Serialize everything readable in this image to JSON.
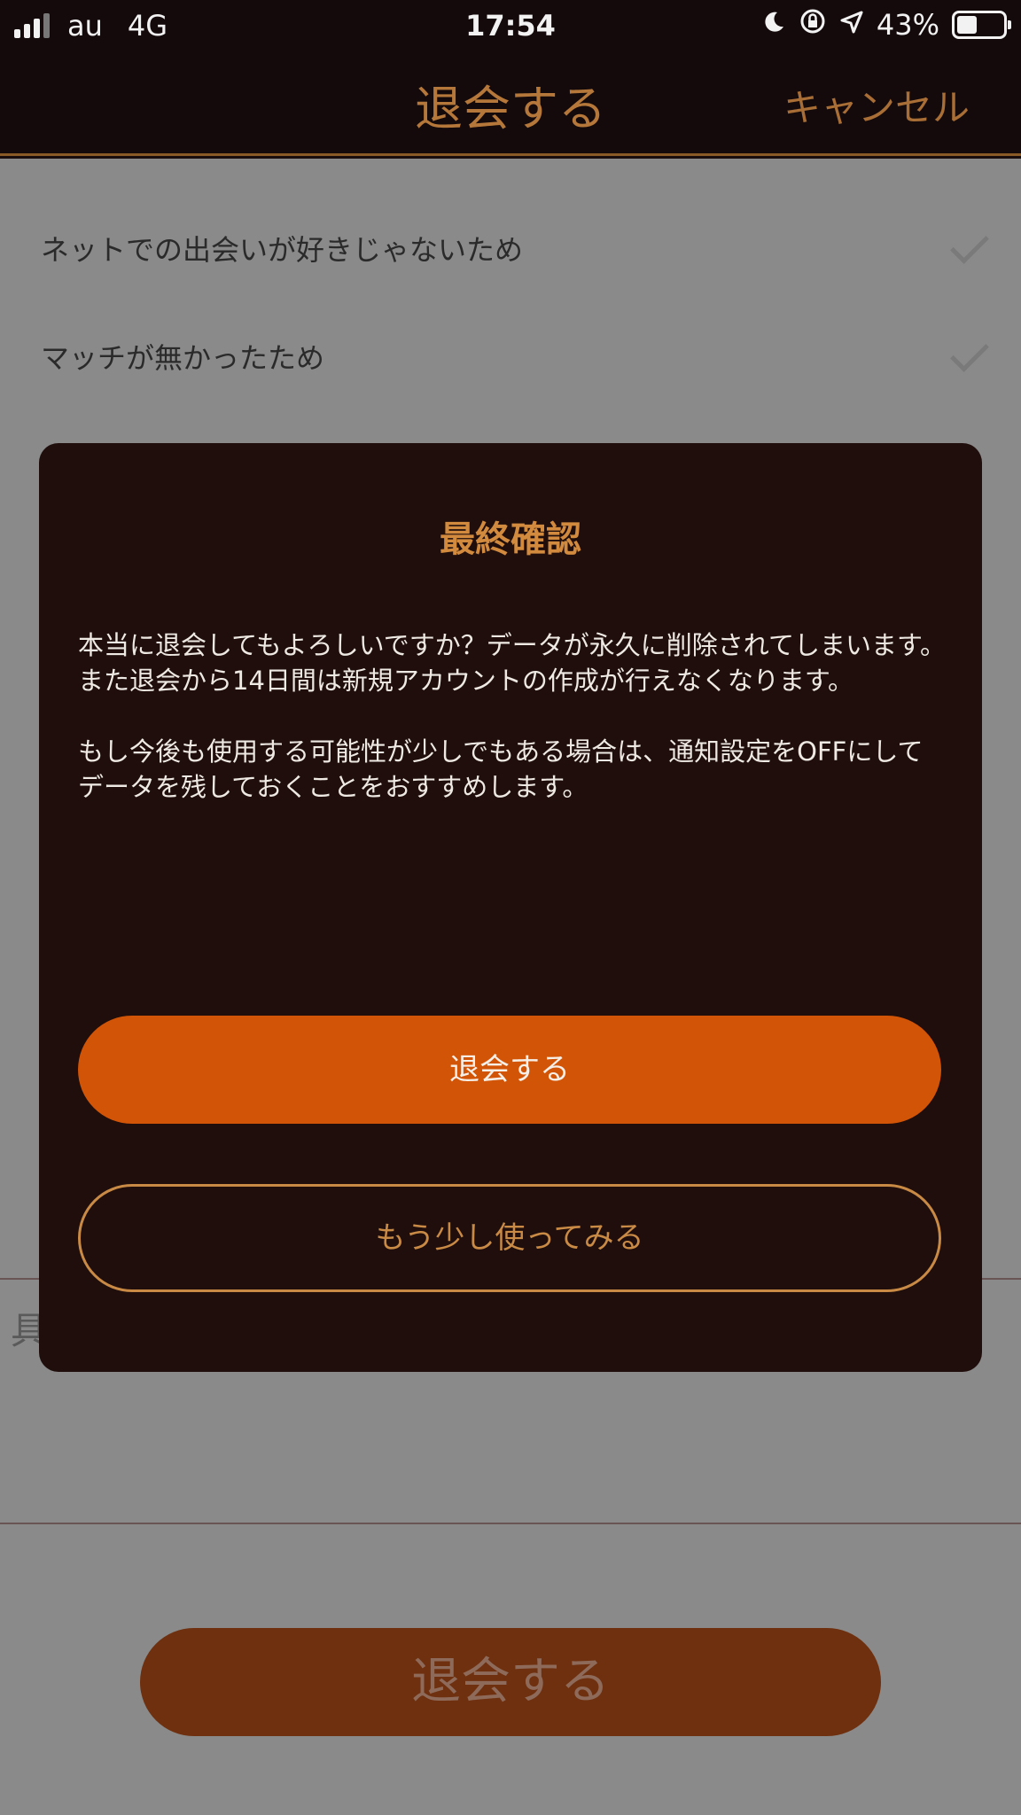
{
  "status_bar": {
    "carrier": "au",
    "network": "4G",
    "time": "17:54",
    "battery": "43%",
    "battery_level": 0.43,
    "icons": [
      "moon-icon",
      "rotation-lock-icon",
      "location-arrow-icon"
    ]
  },
  "nav": {
    "title": "退会する",
    "cancel_label": "キャンセル"
  },
  "reasons": [
    {
      "label": "ネットでの出会いが好きじゃないため"
    },
    {
      "label": "マッチが無かったため"
    }
  ],
  "detail": {
    "placeholder_fragment": "具"
  },
  "withdraw_button_label": "退会する",
  "modal": {
    "title": "最終確認",
    "paragraph1": "本当に退会してもよろしいですか？データが永久に削除されてしまいます。また退会から14日間は新規アカウントの作成が行えなくなります。",
    "paragraph2": "もし今後も使用する可能性が少しでもある場合は、通知設定をOFFにしてデータを残しておくことをおすすめします。",
    "confirm_label": "退会する",
    "keep_label": "もう少し使ってみる"
  },
  "colors": {
    "accent": "#d25406",
    "gold": "#c98a45",
    "modal_bg": "#1f0e0c"
  }
}
